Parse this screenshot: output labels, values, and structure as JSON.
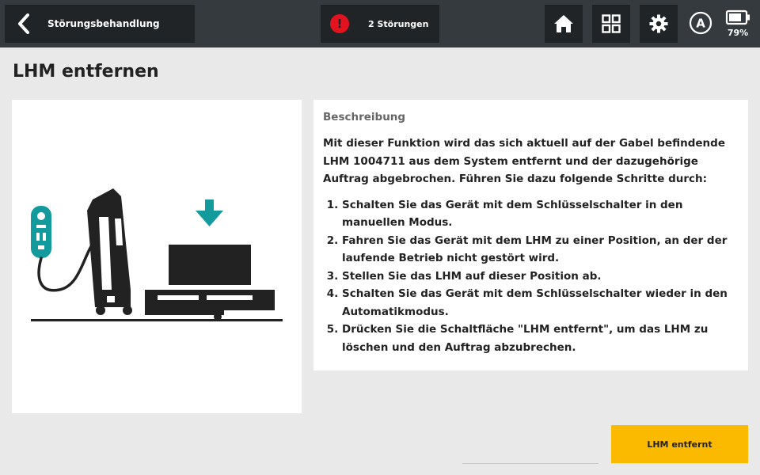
{
  "header": {
    "back_title": "Störungsbehandlung",
    "alarm_text": "2 Störungen",
    "battery_percent": "79%",
    "battery_level": 0.79,
    "mode_label": "A"
  },
  "page": {
    "title": "LHM entfernen"
  },
  "description": {
    "heading": "Beschreibung",
    "intro": "Mit dieser Funktion wird das sich aktuell auf der Gabel befindende LHM 1004711 aus dem System entfernt und der dazugehörige Auftrag abgebrochen. Führen Sie dazu folgende Schritte durch:",
    "steps": [
      "Schalten Sie das Gerät mit dem Schlüsselschalter in den manuellen Modus.",
      "Fahren Sie das Gerät mit dem LHM zu einer Position, an der der laufende Betrieb nicht gestört wird.",
      "Stellen Sie das LHM auf dieser Position ab.",
      "Schalten Sie das Gerät mit dem Schlüsselschalter wieder in den Automatikmodus.",
      "Drücken Sie die Schaltfläche \"LHM entfernt\", um das LHM zu löschen und den Auftrag abzubrechen."
    ]
  },
  "actions": {
    "primary_label": "LHM entfernt"
  },
  "colors": {
    "topbar": "#353a3e",
    "button_dark": "#212427",
    "alarm": "#e3121f",
    "accent_teal": "#139a9c",
    "primary_button": "#fbb900"
  },
  "icons": {
    "back": "chevron-left-icon",
    "alarm": "exclamation-icon",
    "home": "home-icon",
    "grid": "grid-icon",
    "settings": "gear-icon",
    "mode": "circle-a-icon",
    "battery": "battery-icon"
  }
}
